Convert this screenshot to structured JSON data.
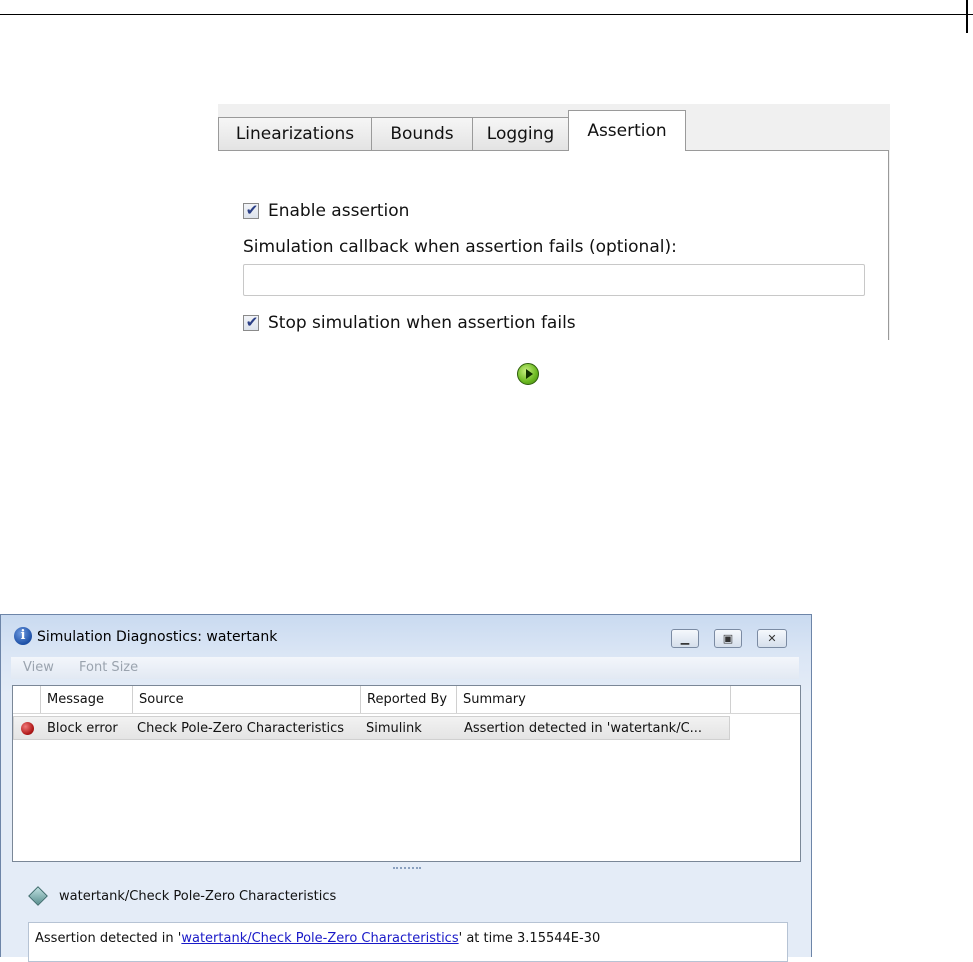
{
  "tabs": [
    {
      "label": "Linearizations",
      "active": false
    },
    {
      "label": "Bounds",
      "active": false
    },
    {
      "label": "Logging",
      "active": false
    },
    {
      "label": "Assertion",
      "active": true
    }
  ],
  "assertion_panel": {
    "enable_assertion": {
      "label": "Enable assertion",
      "checked": true
    },
    "callback_label": "Simulation callback when assertion fails (optional):",
    "callback_value": "",
    "stop_simulation": {
      "label": "Stop simulation when assertion fails",
      "checked": true
    }
  },
  "run_button": {
    "icon": "play-icon",
    "color": "#6ab820"
  },
  "diagnostics_window": {
    "title": "Simulation Diagnostics: watertank",
    "title_icon": "info-icon",
    "controls": {
      "minimize": "minimize-icon",
      "maximize": "maximize-icon",
      "close": "close-icon"
    },
    "menu": [
      "View",
      "Font Size"
    ],
    "columns": [
      "Message",
      "Source",
      "Reported By",
      "Summary"
    ],
    "rows": [
      {
        "icon": "error-icon",
        "message": "Block error",
        "source": "Check Pole-Zero Characteristics",
        "reported_by": "Simulink",
        "summary": "Assertion detected in 'watertank/C..."
      }
    ],
    "selected_block": "watertank/Check Pole-Zero Characteristics",
    "detail": {
      "prefix": "Assertion detected in '",
      "link": "watertank/Check Pole-Zero Characteristics",
      "suffix": "' at time 3.15544E-30"
    },
    "colors": {
      "error": "#b01818",
      "link": "#1a1ac8",
      "titlebar": "#c9daf0"
    }
  }
}
